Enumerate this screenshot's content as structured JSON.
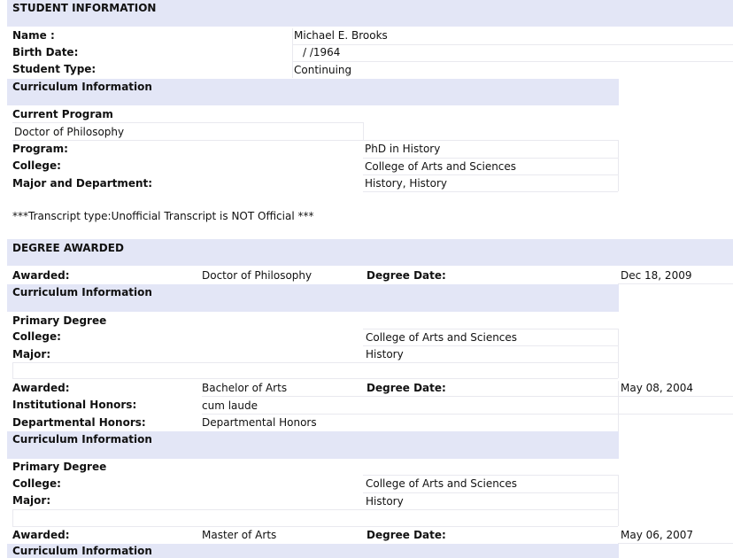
{
  "student_info": {
    "header": "STUDENT INFORMATION",
    "name_label": "Name :",
    "name_value": "Michael E. Brooks",
    "birth_label": "Birth Date:",
    "birth_value": "/  /1964",
    "type_label": "Student Type:",
    "type_value": "Continuing"
  },
  "curriculum": {
    "header": "Curriculum Information",
    "current_program_label": "Current Program",
    "current_program_value": "Doctor of Philosophy",
    "program_label": "Program:",
    "program_value": "PhD in History",
    "college_label": "College:",
    "college_value": "College of Arts and Sciences",
    "major_dept_label": "Major and Department:",
    "major_dept_value": "History, History"
  },
  "transcript_note": "***Transcript type:Unofficial Transcript is NOT Official ***",
  "degrees": {
    "header": "DEGREE AWARDED",
    "awarded_label": "Awarded:",
    "degree_date_label": "Degree Date:",
    "curriculum_label": "Curriculum Information",
    "primary_degree_label": "Primary Degree",
    "college_label": "College:",
    "major_label": "Major:",
    "inst_honors_label": "Institutional Honors:",
    "dept_honors_label": "Departmental Honors:",
    "items": [
      {
        "awarded": "Doctor of Philosophy",
        "date": "Dec 18, 2009",
        "college": "College of Arts and Sciences",
        "major": "History"
      },
      {
        "awarded": "Bachelor of Arts",
        "date": "May 08, 2004",
        "inst_honors": "cum laude",
        "dept_honors": "Departmental Honors",
        "college": "College of Arts and Sciences",
        "major": "History"
      },
      {
        "awarded": "Master of Arts",
        "date": "May 06, 2007"
      }
    ]
  }
}
